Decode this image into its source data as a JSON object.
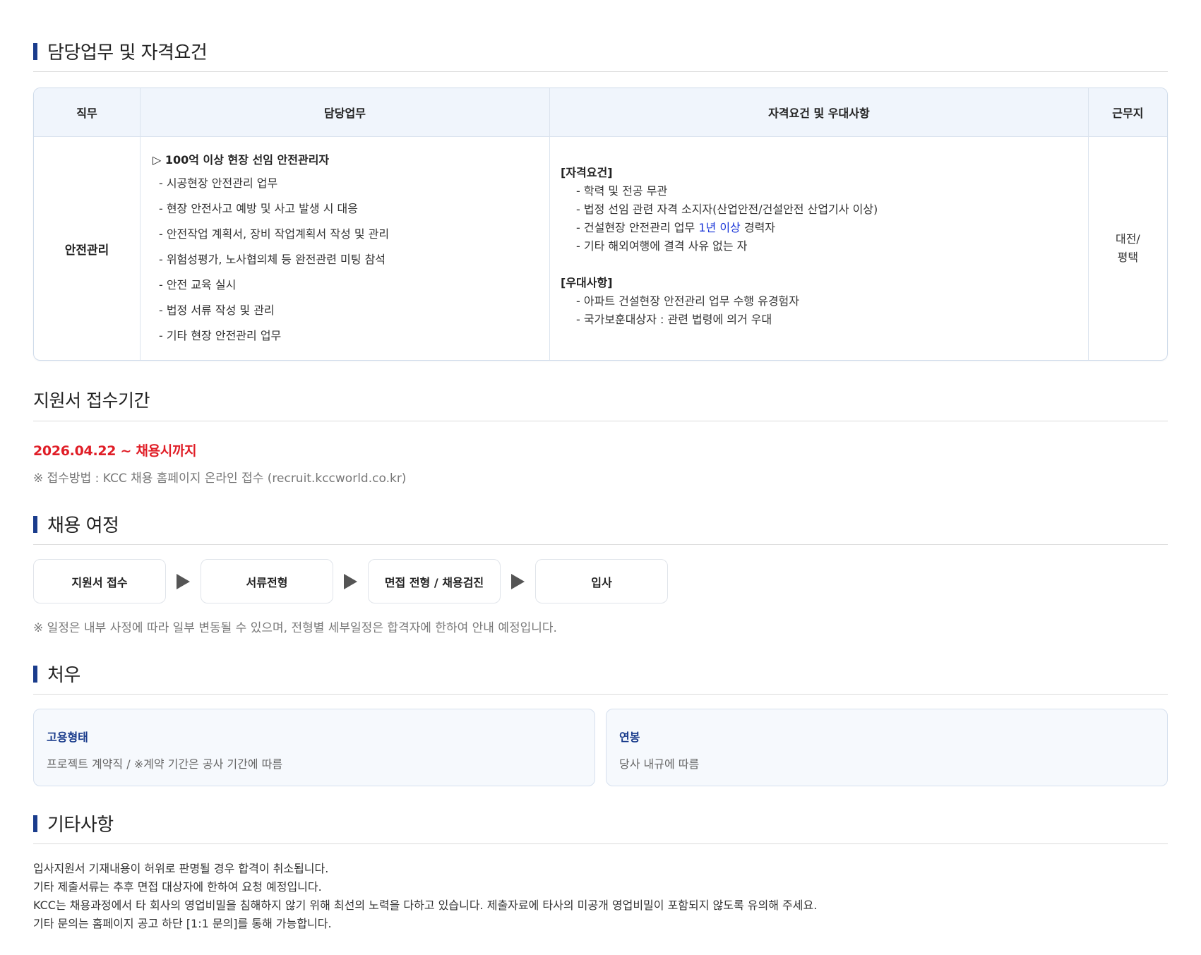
{
  "section_duties": {
    "title": "담당업무 및 자격요건",
    "headers": {
      "job": "직무",
      "duty": "담당업무",
      "qual": "자격요건 및 우대사항",
      "location": "근무지"
    },
    "job": "안전관리",
    "duty_title": "▷ 100억 이상 현장 선임 안전관리자",
    "duty_items": [
      "- 시공현장 안전관리 업무",
      "- 현장 안전사고 예방 및 사고 발생 시 대응",
      "- 안전작업 계획서, 장비 작업계획서 작성 및 관리",
      "- 위험성평가, 노사협의체 등 완전관련 미팅 참석",
      "- 안전 교육 실시",
      "- 법정 서류 작성 및 관리",
      "- 기타 현장 안전관리 업무"
    ],
    "qual_head": "[자격요건]",
    "qual_items": {
      "q1": "- 학력 및 전공 무관",
      "q2": "- 법정 선임 관련 자격 소지자(산업안전/건설안전 산업기사 이상)",
      "q3_pre": "- 건설현장 안전관리 업무 ",
      "q3_hl": "1년 이상",
      "q3_post": " 경력자",
      "q4": "- 기타 해외여행에 결격 사유 없는 자"
    },
    "pref_head": "[우대사항]",
    "pref_items": [
      "- 아파트 건설현장 안전관리 업무 수행 유경험자",
      "- 국가보훈대상자 : 관련 법령에 의거 우대"
    ],
    "location_line1": "대전/",
    "location_line2": "평택"
  },
  "section_period": {
    "title": "지원서 접수기간",
    "period": "2026.04.22 ~ 채용시까지",
    "method": "※ 접수방법 : KCC 채용 홈페이지 온라인 접수 (recruit.kccworld.co.kr)"
  },
  "section_process": {
    "title": "채용 여정",
    "steps": [
      "지원서 접수",
      "서류전형",
      "면접 전형 / 채용검진",
      "입사"
    ],
    "note": "※ 일정은 내부 사정에 따라 일부 변동될 수 있으며, 전형별 세부일정은 합격자에 한하여 안내 예정입니다."
  },
  "section_benefits": {
    "title": "처우",
    "cards": [
      {
        "title": "고용형태",
        "desc": "프로젝트 계약직 / ※계약 기간은 공사 기간에 따름"
      },
      {
        "title": "연봉",
        "desc": "당사 내규에 따름"
      }
    ]
  },
  "section_etc": {
    "title": "기타사항",
    "lines": [
      "입사지원서 기재내용이 허위로 판명될 경우 합격이 취소됩니다.",
      "기타 제출서류는 추후 면접 대상자에 한하여 요청 예정입니다.",
      "KCC는 채용과정에서 타 회사의 영업비밀을 침해하지 않기 위해 최선의 노력을 다하고 있습니다. 제출자료에 타사의 미공개 영업비밀이 포함되지 않도록 유의해 주세요.",
      "기타 문의는 홈페이지 공고 하단 [1:1 문의]를 통해 가능합니다."
    ]
  }
}
